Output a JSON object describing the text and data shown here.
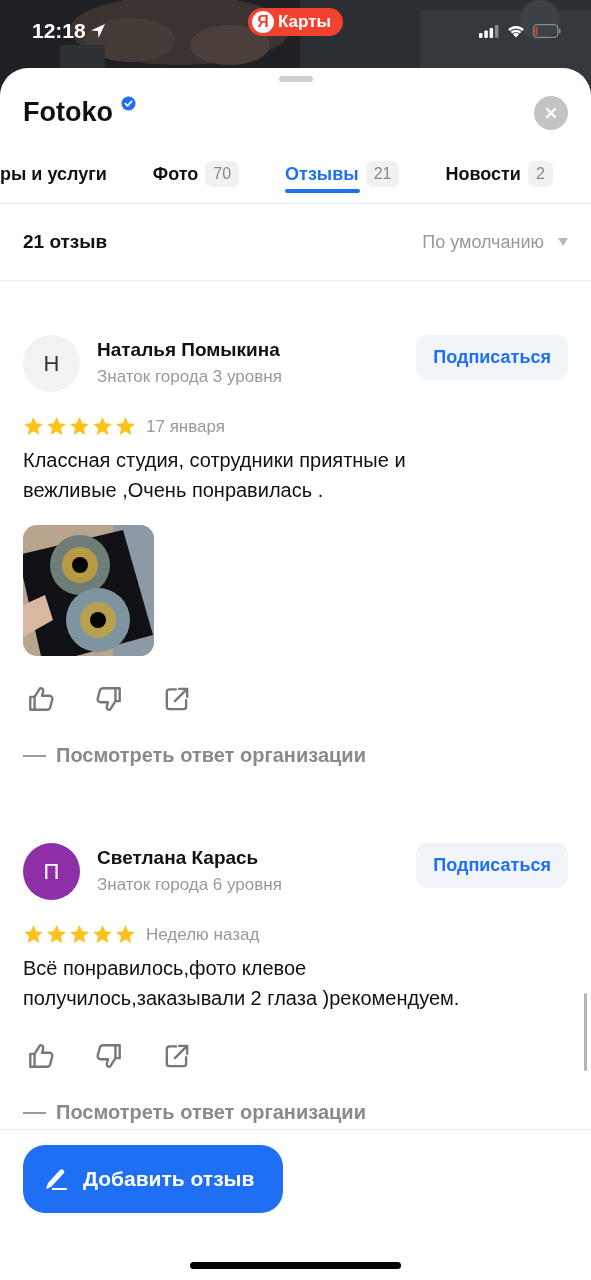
{
  "status_bar": {
    "time": "12:18",
    "app_badge": {
      "logo": "Я",
      "label": "Карты"
    }
  },
  "header": {
    "title": "Fotoko",
    "verified": true
  },
  "tabs": [
    {
      "label": "ры и услуги",
      "selected": false
    },
    {
      "label": "Фото",
      "count": "70",
      "selected": false
    },
    {
      "label": "Отзывы",
      "count": "21",
      "selected": true
    },
    {
      "label": "Новости",
      "count": "2",
      "selected": false
    }
  ],
  "summary": {
    "count": "21 отзыв",
    "sort": "По умолчанию"
  },
  "reviews": [
    {
      "initial": "Н",
      "color": "#f2f2f2",
      "name": "Наталья Помыкина",
      "level": "Знаток города 3 уровня",
      "subscribe": "Подписаться",
      "stars": 5,
      "date": "17 января",
      "text": "Классная студия, сотрудники приятные и вежливые ,Очень понравилась .",
      "reply_link": "Посмотреть ответ организации"
    },
    {
      "initial": "П",
      "color": "#8e2fa8",
      "name": "Светлана Карась",
      "level": "Знаток города 6 уровня",
      "subscribe": "Подписаться",
      "stars": 5,
      "date": "Неделю назад",
      "text": "Всё понравилось,фото клевое получилось,заказывали 2 глаза )рекомендуем.",
      "reply_link": "Посмотреть ответ организации"
    }
  ],
  "add_button": "Добавить отзыв"
}
